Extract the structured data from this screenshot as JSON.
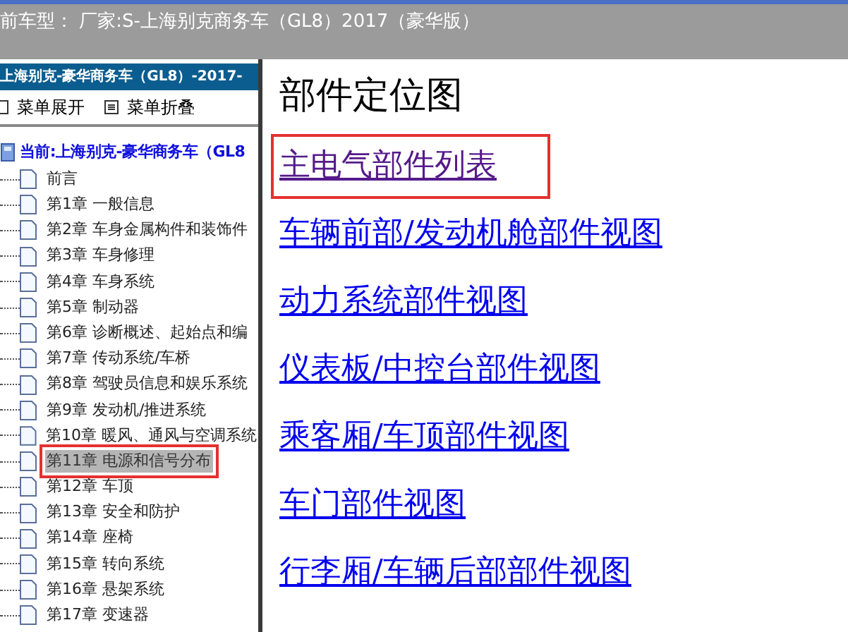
{
  "top_bar": {
    "title": "前车型： 厂家:S-上海别克商务车（GL8）2017（豪华版）"
  },
  "sidebar": {
    "header": "上海别克-豪华商务车（GL8）-2017-",
    "toolbar": [
      "菜单展开",
      "菜单折叠"
    ],
    "tree": {
      "label": "当前:上海别克-豪华商务车（GL8",
      "children": [
        {
          "label": "前言",
          "selected": false
        },
        {
          "label": "第1章 一般信息",
          "selected": false
        },
        {
          "label": "第2章 车身金属构件和装饰件",
          "selected": false
        },
        {
          "label": "第3章 车身修理",
          "selected": false
        },
        {
          "label": "第4章 车身系统",
          "selected": false
        },
        {
          "label": "第5章 制动器",
          "selected": false
        },
        {
          "label": "第6章 诊断概述、起始点和编",
          "selected": false
        },
        {
          "label": "第7章 传动系统/车桥",
          "selected": false
        },
        {
          "label": "第8章 驾驶员信息和娱乐系统",
          "selected": false
        },
        {
          "label": "第9章 发动机/推进系统",
          "selected": false
        },
        {
          "label": "第10章 暖风、通风与空调系统",
          "selected": false
        },
        {
          "label": "第11章 电源和信号分布",
          "selected": true
        },
        {
          "label": "第12章 车顶",
          "selected": false
        },
        {
          "label": "第13章 安全和防护",
          "selected": false
        },
        {
          "label": "第14章 座椅",
          "selected": false
        },
        {
          "label": "第15章 转向系统",
          "selected": false
        },
        {
          "label": "第16章 悬架系统",
          "selected": false
        },
        {
          "label": "第17章 变速器",
          "selected": false
        }
      ]
    }
  },
  "content": {
    "title": "部件定位图",
    "links": [
      {
        "label": "主电气部件列表",
        "visited": true,
        "highlighted": true
      },
      {
        "label": "车辆前部/发动机舱部件视图",
        "visited": false,
        "highlighted": false
      },
      {
        "label": "动力系统部件视图",
        "visited": false,
        "highlighted": false
      },
      {
        "label": "仪表板/中控台部件视图",
        "visited": false,
        "highlighted": false
      },
      {
        "label": "乘客厢/车顶部件视图",
        "visited": false,
        "highlighted": false
      },
      {
        "label": "车门部件视图",
        "visited": false,
        "highlighted": false
      },
      {
        "label": "行李厢/车辆后部部件视图",
        "visited": false,
        "highlighted": false
      }
    ]
  }
}
